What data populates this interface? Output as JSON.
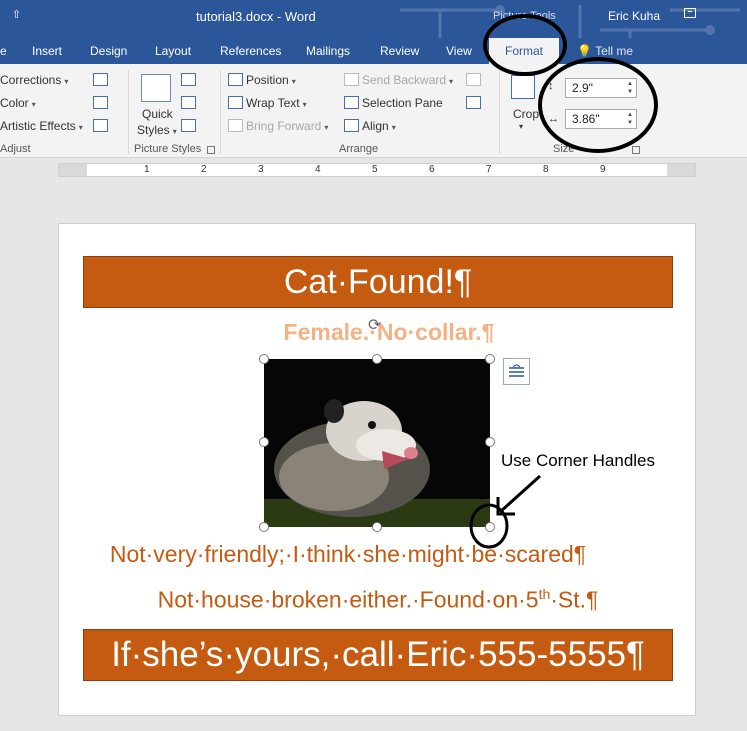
{
  "titlebar": {
    "qat": "⇧",
    "doc_title": "tutorial3.docx  -  Word",
    "context_label": "Picture Tools",
    "user_name": "Eric Kuha"
  },
  "tabs": [
    {
      "label": "e"
    },
    {
      "label": "Insert"
    },
    {
      "label": "Design"
    },
    {
      "label": "Layout"
    },
    {
      "label": "References"
    },
    {
      "label": "Mailings"
    },
    {
      "label": "Review"
    },
    {
      "label": "View"
    },
    {
      "label": "Format"
    }
  ],
  "tell_me": "Tell me",
  "ribbon": {
    "adjust": {
      "corrections": "Corrections",
      "color": "Color",
      "artistic_effects": "Artistic Effects",
      "label": "Adjust"
    },
    "picture_styles": {
      "quick_line1": "Quick",
      "quick_line2": "Styles",
      "label": "Picture Styles"
    },
    "arrange": {
      "position": "Position",
      "wrap_text": "Wrap Text",
      "bring_forward": "Bring Forward",
      "send_backward": "Send Backward",
      "selection_pane": "Selection Pane",
      "align": "Align",
      "label": "Arrange"
    },
    "size": {
      "crop": "Crop",
      "height": "2.9\"",
      "width": "3.86\"",
      "label": "Size"
    }
  },
  "ruler_numbers": [
    "1",
    "2",
    "3",
    "4",
    "5",
    "6",
    "7",
    "8",
    "9"
  ],
  "document": {
    "title": "Cat·Found!¶",
    "subtitle": "Female.·No·collar.¶",
    "line1": "Not·very·friendly;·I·think·she·might·be·scared¶",
    "line2_prefix": "Not·house·broken·either.·Found·on·5",
    "line2_sup": "th",
    "line2_suffix": "·St.¶",
    "contact": "If·she’s·yours,·call·Eric·555-5555¶"
  },
  "annotation": {
    "text": "Use Corner Handles"
  },
  "colors": {
    "word_blue": "#2b579a",
    "banner_orange": "#c55a11",
    "subtitle_orange": "#f4b183"
  }
}
